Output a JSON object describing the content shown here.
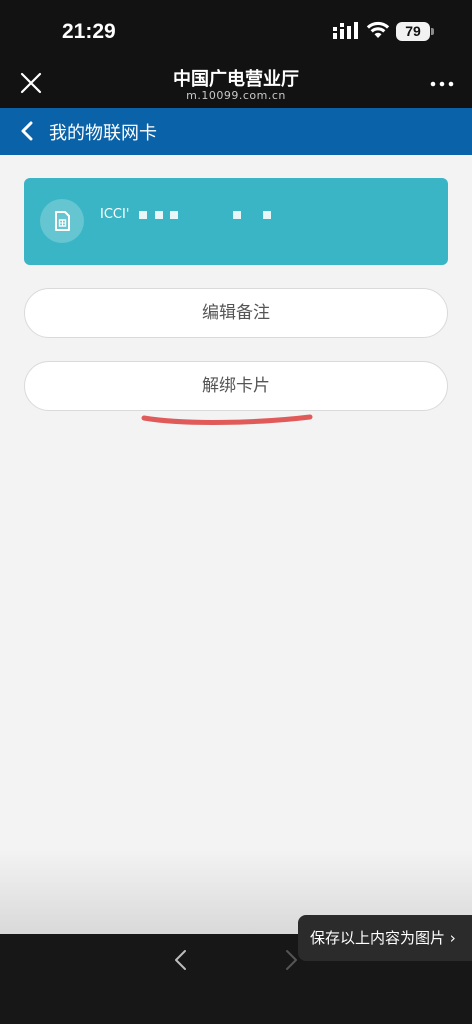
{
  "status_bar": {
    "time": "21:29",
    "battery": "79"
  },
  "browser": {
    "title": "中国广电营业厅",
    "url": "m.10099.com.cn"
  },
  "nav": {
    "title": "我的物联网卡"
  },
  "card": {
    "label": "ICCI'"
  },
  "actions": {
    "edit_note": "编辑备注",
    "unbind_card": "解绑卡片"
  },
  "save_tip": {
    "label": "保存以上内容为图片 ›"
  },
  "colors": {
    "nav_blue": "#0a62a8",
    "card_teal": "#3ab5c5",
    "underline_red": "#e05a5a"
  }
}
